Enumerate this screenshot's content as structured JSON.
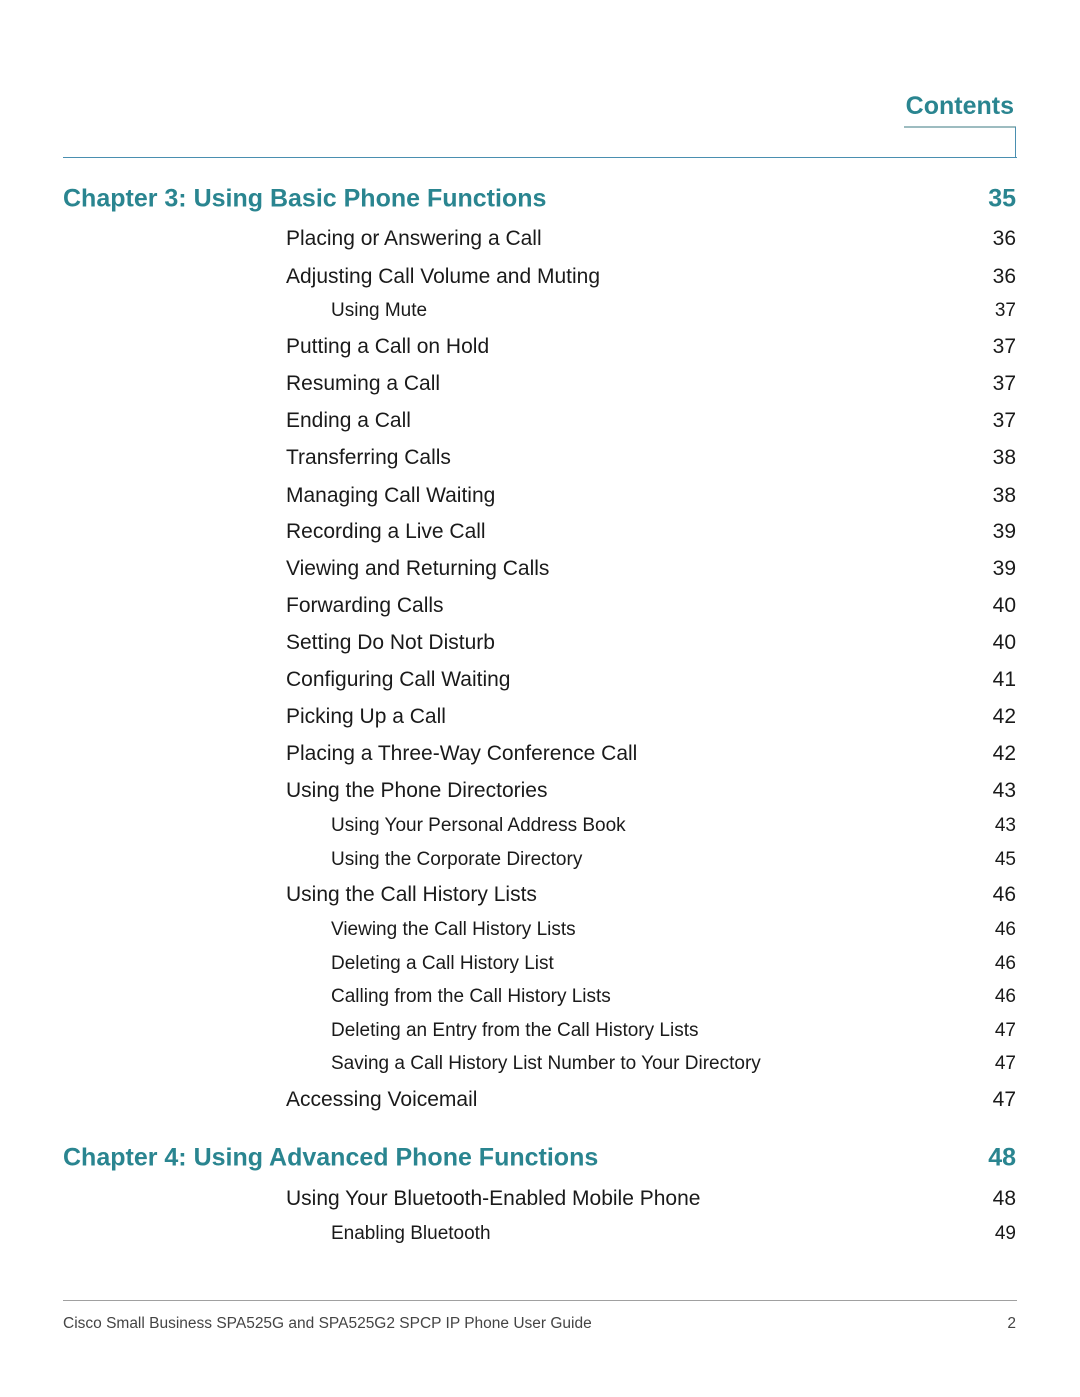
{
  "header": {
    "title": "Contents"
  },
  "toc": [
    {
      "level": "ch",
      "title": "Chapter 3: Using Basic Phone Functions",
      "page": "35"
    },
    {
      "level": "l1",
      "title": "Placing or Answering a Call",
      "page": "36"
    },
    {
      "level": "l1",
      "title": "Adjusting Call Volume and Muting",
      "page": "36"
    },
    {
      "level": "l2",
      "title": "Using Mute",
      "page": "37"
    },
    {
      "level": "l1",
      "title": "Putting a Call on Hold",
      "page": "37"
    },
    {
      "level": "l1",
      "title": "Resuming a Call",
      "page": "37"
    },
    {
      "level": "l1",
      "title": "Ending a Call",
      "page": "37"
    },
    {
      "level": "l1",
      "title": "Transferring Calls",
      "page": "38"
    },
    {
      "level": "l1",
      "title": "Managing Call Waiting",
      "page": "38"
    },
    {
      "level": "l1",
      "title": "Recording a Live Call",
      "page": "39"
    },
    {
      "level": "l1",
      "title": "Viewing and Returning Calls",
      "page": "39"
    },
    {
      "level": "l1",
      "title": "Forwarding Calls",
      "page": "40"
    },
    {
      "level": "l1",
      "title": "Setting Do Not Disturb",
      "page": "40"
    },
    {
      "level": "l1",
      "title": "Configuring Call Waiting",
      "page": "41"
    },
    {
      "level": "l1",
      "title": "Picking Up a Call",
      "page": "42"
    },
    {
      "level": "l1",
      "title": "Placing a Three-Way Conference Call",
      "page": "42"
    },
    {
      "level": "l1",
      "title": "Using the Phone Directories",
      "page": "43"
    },
    {
      "level": "l2",
      "title": "Using Your Personal Address Book",
      "page": "43"
    },
    {
      "level": "l2",
      "title": "Using the Corporate Directory",
      "page": "45"
    },
    {
      "level": "l1",
      "title": "Using the Call History Lists",
      "page": "46"
    },
    {
      "level": "l2",
      "title": "Viewing the Call History Lists",
      "page": "46"
    },
    {
      "level": "l2",
      "title": "Deleting a Call History List",
      "page": "46"
    },
    {
      "level": "l2",
      "title": "Calling from the Call History Lists",
      "page": "46"
    },
    {
      "level": "l2",
      "title": "Deleting an Entry from the Call History Lists",
      "page": "47"
    },
    {
      "level": "l2",
      "title": "Saving a Call History List Number to Your Directory",
      "page": "47"
    },
    {
      "level": "l1",
      "title": "Accessing Voicemail",
      "page": "47"
    },
    {
      "level": "ch",
      "title": "Chapter 4: Using Advanced Phone Functions",
      "page": "48"
    },
    {
      "level": "l1",
      "title": "Using Your Bluetooth-Enabled Mobile Phone",
      "page": "48"
    },
    {
      "level": "l2",
      "title": "Enabling Bluetooth",
      "page": "49"
    }
  ],
  "footer": {
    "text": "Cisco Small Business SPA525G and SPA525G2 SPCP IP Phone User Guide",
    "page": "2"
  }
}
